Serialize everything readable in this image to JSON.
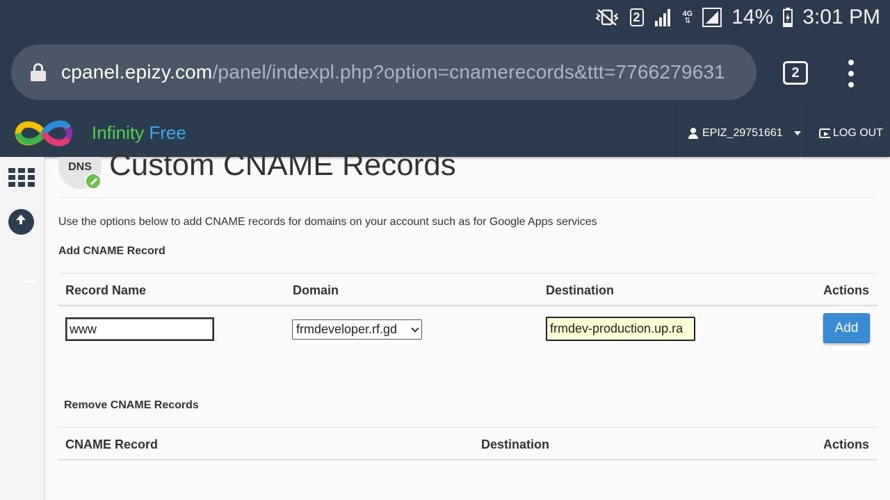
{
  "status_bar": {
    "sim_number": "2",
    "network_type": "4G",
    "battery": "14%",
    "time": "3:01 PM"
  },
  "browser": {
    "url_host": "cpanel.epizy.com",
    "url_path": "/panel/indexpl.php?option=cnamerecords&ttt=7766279631",
    "tab_count": "2"
  },
  "header": {
    "brand_infinity": "Infinity",
    "brand_free": "Free",
    "username": "EPIZ_29751661",
    "logout_label": "LOG OUT"
  },
  "page": {
    "badge": "DNS",
    "title": "Custom CNAME Records",
    "intro": "Use the options below to add CNAME records for domains on your account such as for Google Apps services",
    "add_heading": "Add CNAME Record",
    "add_columns": [
      "Record Name",
      "Domain",
      "Destination",
      "Actions"
    ],
    "form": {
      "record_name": "www",
      "domain": "frmdeveloper.rf.gd",
      "destination": "frmdev-production.up.ra",
      "add_label": "Add"
    },
    "remove_heading": "Remove CNAME Records",
    "remove_columns": [
      "CNAME Record",
      "Destination",
      "Actions"
    ]
  },
  "colors": {
    "status_bg": "#2b3a4c",
    "header_bg": "#2c3c4f",
    "brand_green": "#4fd34a",
    "brand_blue": "#3fa4e8",
    "add_button": "#3a8ad4",
    "destination_bg": "#fdfdd6"
  }
}
